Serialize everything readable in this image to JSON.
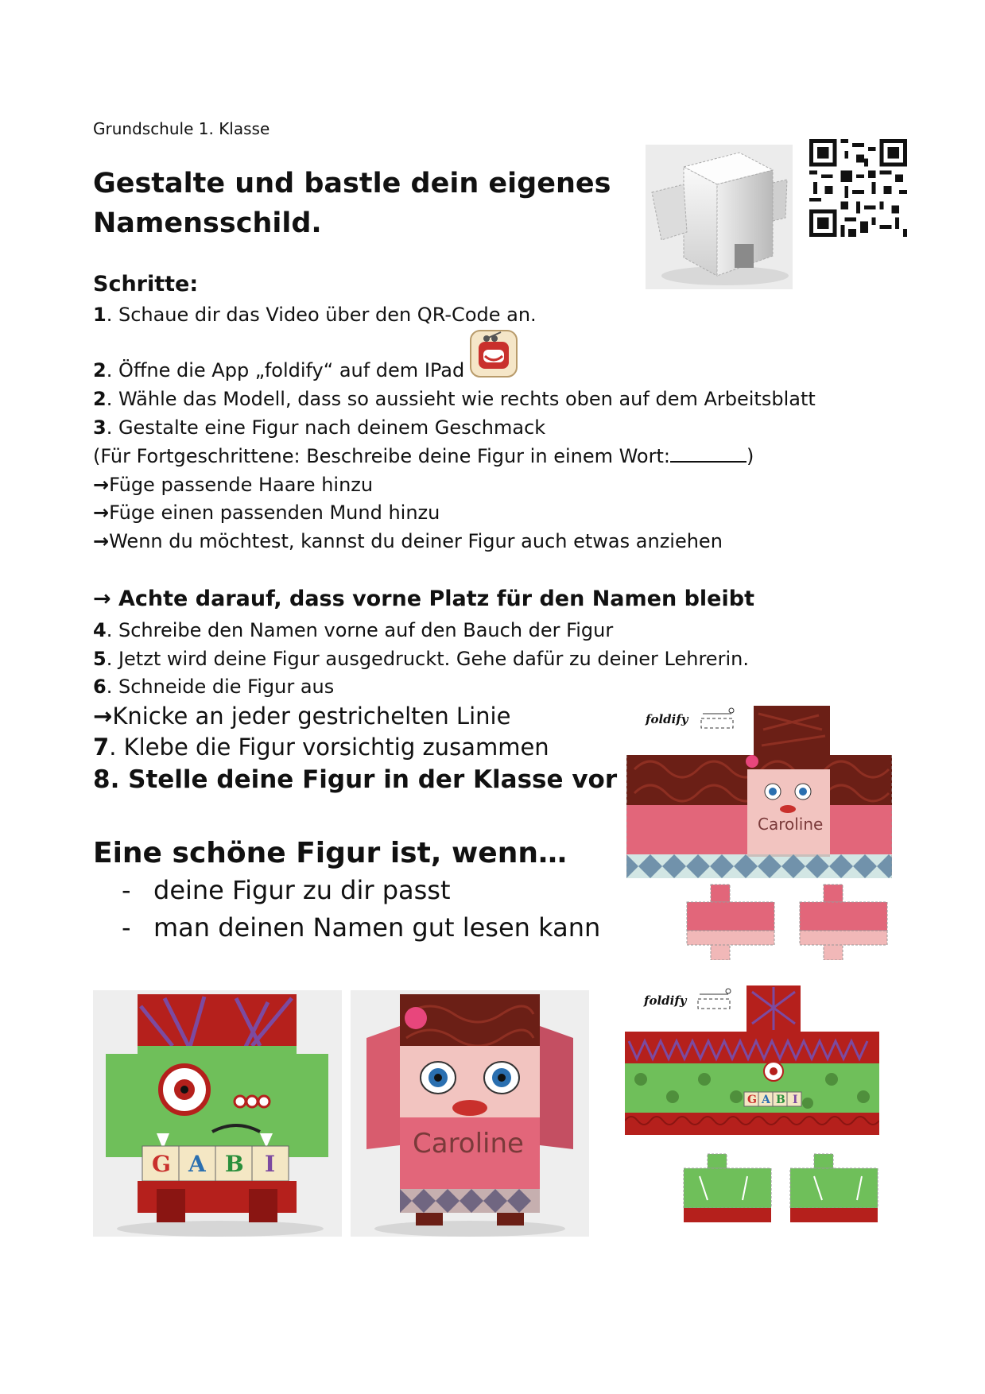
{
  "header": {
    "grade": "Grundschule 1. Klasse",
    "title_line1": "Gestalte und bastle dein eigenes",
    "title_line2": "Namensschild."
  },
  "steps": {
    "heading": "Schritte:",
    "s1_num": "1",
    "s1_text": ". Schaue dir das Video über den QR-Code an.",
    "s2a_num": "2",
    "s2a_text": ". Öffne die App „foldify“ auf dem IPad",
    "s2b_num": "2",
    "s2b_text": ". Wähle das Modell, dass so aussieht wie rechts oben auf dem Arbeitsblatt",
    "s3_num": "3",
    "s3_text": ". Gestalte eine Figur nach deinem Geschmack",
    "advanced_text": "(Für Fortgeschrittene: Beschreibe deine Figur in einem Wort:",
    "advanced_close": ")",
    "arrow": "→",
    "tip1": "Füge passende Haare hinzu",
    "tip2": "Füge einen passenden Mund hinzu",
    "tip3": "Wenn du möchtest, kannst du deiner Figur auch etwas anziehen",
    "important": " Achte darauf, dass vorne Platz für den Namen bleibt",
    "s4_num": "4",
    "s4_text": ". Schreibe den Namen vorne auf den Bauch der Figur",
    "s5_num": "5",
    "s5_text": ". Jetzt wird deine Figur ausgedruckt. Gehe dafür zu deiner Lehrerin.",
    "s6_num": "6",
    "s6_text": ". Schneide die Figur aus",
    "fold": "Knicke an jeder gestrichelten Linie",
    "s7_num": "7",
    "s7_text": ". Klebe die Figur vorsichtig zusammen",
    "s8": "8. Stelle deine Figur in der Klasse vor"
  },
  "criteria": {
    "heading": "Eine schöne Figur ist, wenn…",
    "dash": "-",
    "items": [
      "deine Figur zu dir passt",
      "man deinen Namen gut lesen kann"
    ]
  },
  "images": {
    "logo": "foldify",
    "name_caroline": "Caroline",
    "name_gabi": [
      "G",
      "A",
      "B",
      "I"
    ],
    "icons": [
      "qr-code-icon",
      "foldify-app-icon",
      "scissors-icon"
    ]
  },
  "colors": {
    "pink": "#e2667a",
    "hair": "#6b1f16",
    "green": "#6fbf5a",
    "red": "#b5201c",
    "purple": "#7c4aa0"
  }
}
